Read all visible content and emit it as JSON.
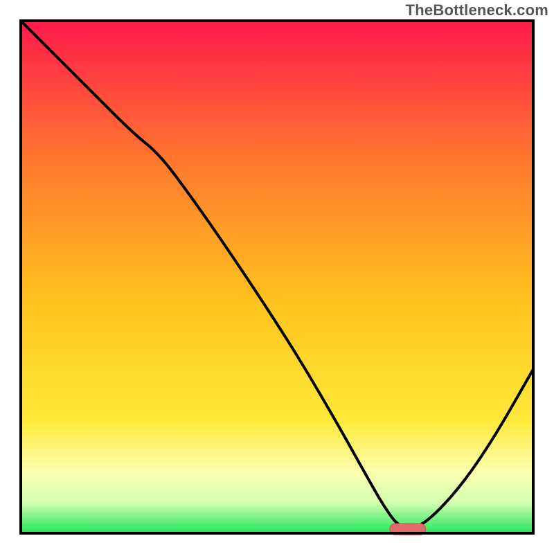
{
  "watermark": "TheBottleneck.com",
  "colors": {
    "top": "#ff1a4b",
    "upper_mid": "#ff7a2e",
    "mid": "#ffc31f",
    "lower_mid": "#ffe93a",
    "pale": "#fbffb0",
    "bottom_pale": "#d4ffb0",
    "green": "#1fe65b",
    "curve": "#000000",
    "border": "#000000",
    "marker_fill": "#e06a6a",
    "marker_stroke": "#d24f4f"
  },
  "plot": {
    "inner_x": 30,
    "inner_y": 30,
    "inner_w": 740,
    "inner_h": 740,
    "border_width": 4
  },
  "chart_data": {
    "type": "line",
    "title": "",
    "xlabel": "",
    "ylabel": "",
    "xlim": [
      0,
      100
    ],
    "ylim": [
      0,
      100
    ],
    "grid": false,
    "legend": false,
    "annotations": [],
    "series": [
      {
        "name": "curve",
        "x": [
          0,
          6,
          14,
          22,
          27,
          33,
          40,
          48,
          55,
          62,
          67,
          71,
          74,
          78,
          85,
          92,
          100
        ],
        "y": [
          100,
          94,
          86,
          78,
          74,
          66,
          56,
          44,
          33,
          21,
          12,
          5,
          1,
          1,
          8,
          18,
          32
        ]
      }
    ],
    "marker": {
      "x_start": 72,
      "x_end": 79,
      "y": 0.8,
      "height": 2.2
    }
  }
}
